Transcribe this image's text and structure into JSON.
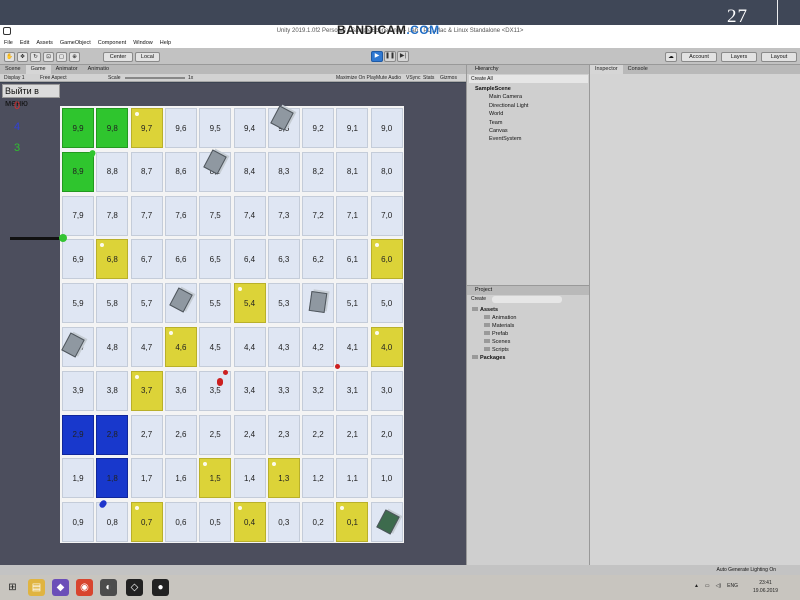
{
  "slide": {
    "number": "27"
  },
  "window": {
    "title": "Unity 2019.1.0f2 Personal - SampleScene.unity - Lab - PC, Mac & Linux Standalone <DX11>",
    "recorder": "BANDICAM",
    "recorder_suffix": ".COM"
  },
  "menu": [
    "File",
    "Edit",
    "Assets",
    "GameObject",
    "Component",
    "Window",
    "Help"
  ],
  "toolbar": {
    "pivot": "Center",
    "space": "Local",
    "account": "Account",
    "layers": "Layers",
    "layout": "Layout"
  },
  "game_panel": {
    "tabs": [
      "Scene",
      "Game",
      "Animator",
      "Animatio"
    ],
    "display": "Display 1",
    "aspect": "Free Aspect",
    "scale_label": "Scale",
    "scale_value": "1x",
    "maximize": "Maximize On Play",
    "mute": "Mute Audio",
    "vsync": "VSync",
    "stats": "Stats",
    "gizmos": "Gizmos"
  },
  "game": {
    "exit_button": "Выйти в меню",
    "scores": [
      {
        "value": "0",
        "color": "#d92b2b"
      },
      {
        "value": "4",
        "color": "#3040d8"
      },
      {
        "value": "3",
        "color": "#2fbf2f"
      }
    ],
    "rows": [
      [
        "9,9",
        "9,8",
        "9,7",
        "9,6",
        "9,5",
        "9,4",
        "9,3",
        "9,2",
        "9,1",
        "9,0"
      ],
      [
        "8,9",
        "8,8",
        "8,7",
        "8,6",
        "8,5",
        "8,4",
        "8,3",
        "8,2",
        "8,1",
        "8,0"
      ],
      [
        "7,9",
        "7,8",
        "7,7",
        "7,6",
        "7,5",
        "7,4",
        "7,3",
        "7,2",
        "7,1",
        "7,0"
      ],
      [
        "6,9",
        "6,8",
        "6,7",
        "6,6",
        "6,5",
        "6,4",
        "6,3",
        "6,2",
        "6,1",
        "6,0"
      ],
      [
        "5,9",
        "5,8",
        "5,7",
        "5,6",
        "5,5",
        "5,4",
        "5,3",
        "5,2",
        "5,1",
        "5,0"
      ],
      [
        "4,9",
        "4,8",
        "4,7",
        "4,6",
        "4,5",
        "4,4",
        "4,3",
        "4,2",
        "4,1",
        "4,0"
      ],
      [
        "3,9",
        "3,8",
        "3,7",
        "3,6",
        "3,5",
        "3,4",
        "3,3",
        "3,2",
        "3,1",
        "3,0"
      ],
      [
        "2,9",
        "2,8",
        "2,7",
        "2,6",
        "2,5",
        "2,4",
        "2,3",
        "2,2",
        "2,1",
        "2,0"
      ],
      [
        "1,9",
        "1,8",
        "1,7",
        "1,6",
        "1,5",
        "1,4",
        "1,3",
        "1,2",
        "1,1",
        "1,0"
      ],
      [
        "0,9",
        "0,8",
        "0,7",
        "0,6",
        "0,5",
        "0,4",
        "0,3",
        "0,2",
        "0,1",
        "0,0"
      ]
    ],
    "cell_colors": {
      "green": [
        "9,9",
        "9,8",
        "8,9"
      ],
      "yellow": [
        "9,7",
        "6,8",
        "6,0",
        "5,4",
        "4,6",
        "4,0",
        "3,7",
        "1,5",
        "1,3",
        "0,7",
        "0,4",
        "0,1"
      ],
      "blue": [
        "2,9",
        "2,8",
        "1,8"
      ]
    },
    "colors": {
      "cell": "#dfe6f3",
      "yellow": "#dcd338",
      "green": "#2fc52e",
      "blue": "#1838cc"
    }
  },
  "hierarchy": {
    "tab": "Hierarchy",
    "create": "Create",
    "search": "All",
    "scene": "SampleScene",
    "items": [
      "Main Camera",
      "Directional Light",
      "World",
      "Team",
      "Canvas",
      "EventSystem"
    ]
  },
  "project": {
    "tab": "Project",
    "create": "Create",
    "assets": "Assets",
    "folders": [
      "Animation",
      "Materials",
      "Prefab",
      "Scenes",
      "Scripts"
    ],
    "packages": "Packages"
  },
  "inspector": {
    "tabs": [
      "Inspector",
      "Console"
    ]
  },
  "status_bar": {
    "text": "Auto Generate Lighting On"
  },
  "taskbar": {
    "language": "ENG",
    "time": "23:41",
    "date": "19.06.2019"
  }
}
